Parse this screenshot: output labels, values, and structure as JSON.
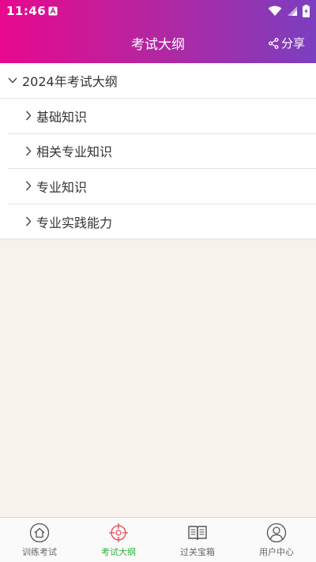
{
  "status_bar": {
    "time": "11:46",
    "icons": [
      "app-notification-icon",
      "wifi-icon",
      "cellular-signal-icon",
      "battery-charging-icon"
    ]
  },
  "header": {
    "title": "考试大纲",
    "share_label": "分享",
    "gradient_colors": [
      "#e8088e",
      "#7b3fbf"
    ]
  },
  "outline": {
    "section_title": "2024年考试大纲",
    "items": [
      {
        "label": "基础知识"
      },
      {
        "label": "相关专业知识"
      },
      {
        "label": "专业知识"
      },
      {
        "label": "专业实践能力"
      }
    ]
  },
  "tabbar": {
    "active_color": "#2db33b",
    "tabs": [
      {
        "label": "训练考试",
        "icon": "home-icon"
      },
      {
        "label": "考试大纲",
        "icon": "crosshair-target-icon",
        "active": true
      },
      {
        "label": "过关宝箱",
        "icon": "open-book-icon"
      },
      {
        "label": "用户中心",
        "icon": "user-icon"
      }
    ]
  }
}
